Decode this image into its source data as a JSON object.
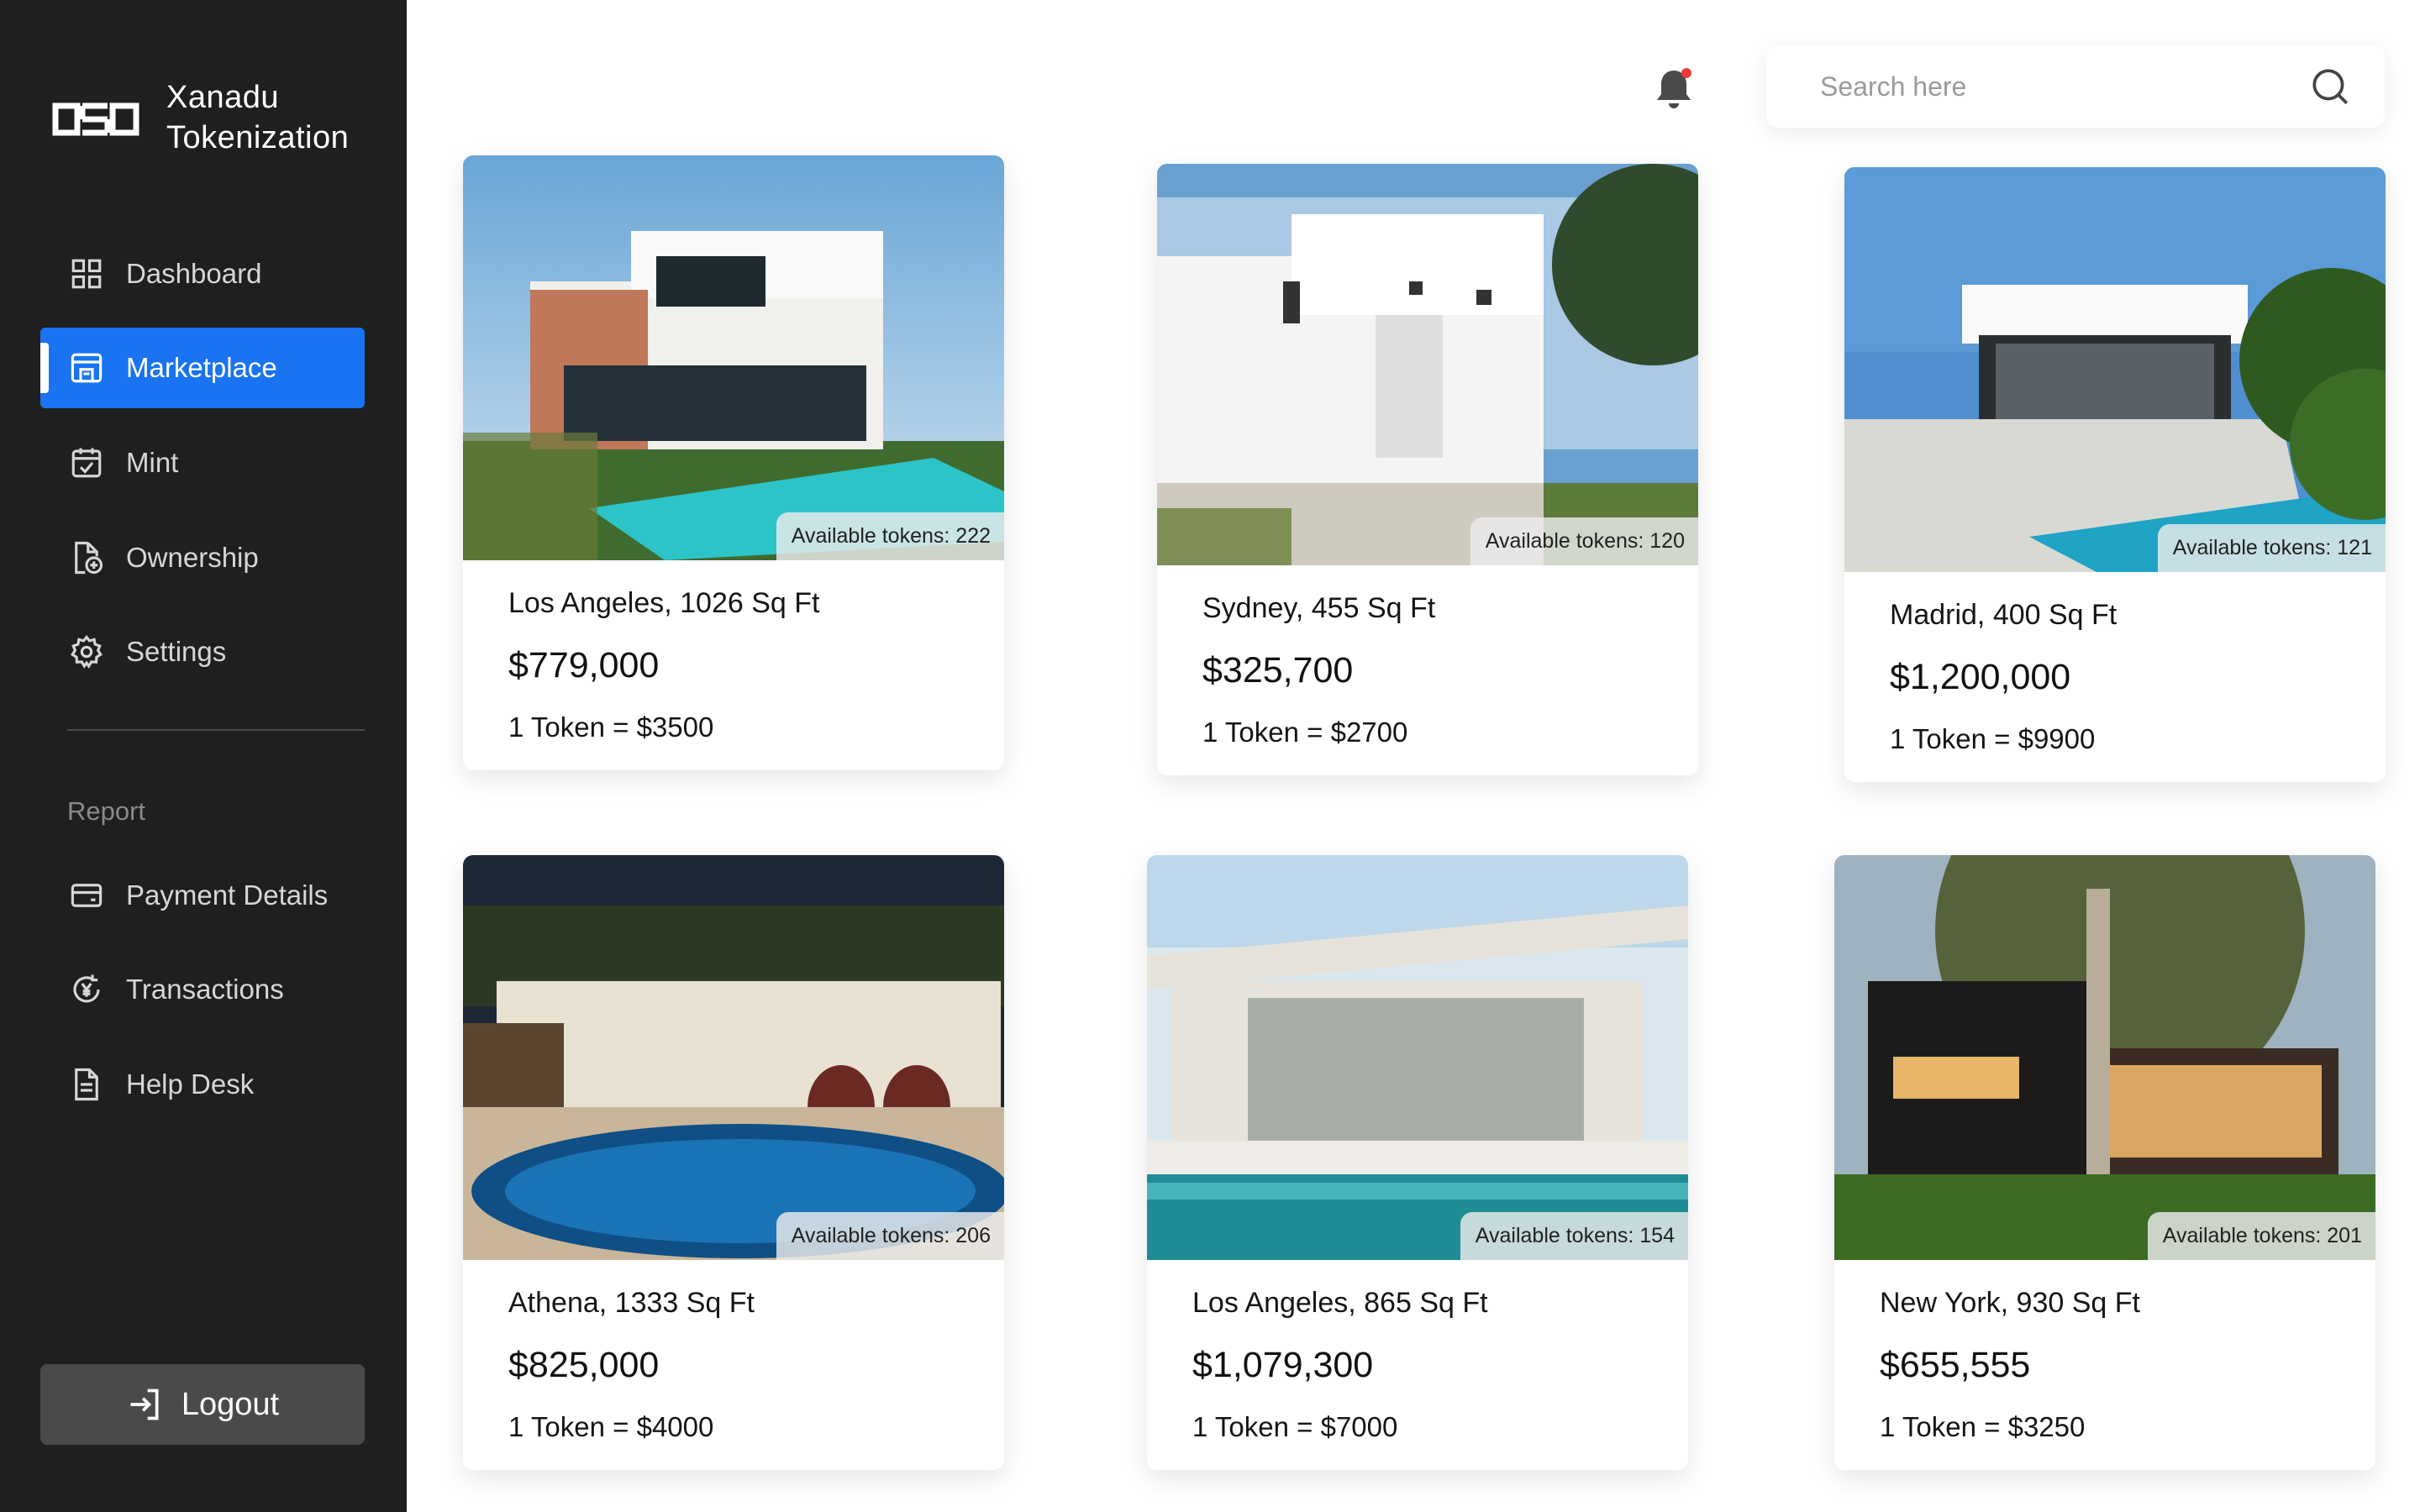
{
  "brand": {
    "line1": "Xanadu",
    "line2": "Tokenization",
    "logo_icon": "xanadu-logo-icon"
  },
  "sidebar": {
    "items": [
      {
        "label": "Dashboard",
        "icon": "grid-icon",
        "active": false
      },
      {
        "label": "Marketplace",
        "icon": "storefront-icon",
        "active": true
      },
      {
        "label": "Mint",
        "icon": "calendar-check-icon",
        "active": false
      },
      {
        "label": "Ownership",
        "icon": "document-add-icon",
        "active": false
      },
      {
        "label": "Settings",
        "icon": "gear-icon",
        "active": false
      }
    ],
    "section_label": "Report",
    "report_items": [
      {
        "label": "Payment Details",
        "icon": "card-icon"
      },
      {
        "label": "Transactions",
        "icon": "yen-cycle-icon"
      },
      {
        "label": "Help Desk",
        "icon": "document-icon"
      }
    ],
    "logout_label": "Logout"
  },
  "header": {
    "search_placeholder": "Search here",
    "notification_dot_color": "#ef3b3b"
  },
  "colors": {
    "accent": "#1a73f0",
    "sidebar_bg": "#1f1f1f"
  },
  "listings": [
    {
      "title": "Los Angeles, 1026 Sq Ft",
      "price": "$779,000",
      "token": "1 Token = $3500",
      "available": "Available tokens: 222"
    },
    {
      "title": "Sydney, 455 Sq Ft",
      "price": "$325,700",
      "token": "1 Token = $2700",
      "available": "Available tokens: 120"
    },
    {
      "title": "Madrid, 400 Sq Ft",
      "price": "$1,200,000",
      "token": "1 Token = $9900",
      "available": "Available tokens: 121"
    },
    {
      "title": "Athena, 1333 Sq Ft",
      "price": "$825,000",
      "token": "1 Token = $4000",
      "available": "Available tokens: 206"
    },
    {
      "title": "Los Angeles, 865 Sq Ft",
      "price": "$1,079,300",
      "token": "1 Token = $7000",
      "available": "Available tokens: 154"
    },
    {
      "title": "New York, 930 Sq Ft",
      "price": "$655,555",
      "token": "1 Token = $3250",
      "available": "Available tokens: 201"
    }
  ]
}
